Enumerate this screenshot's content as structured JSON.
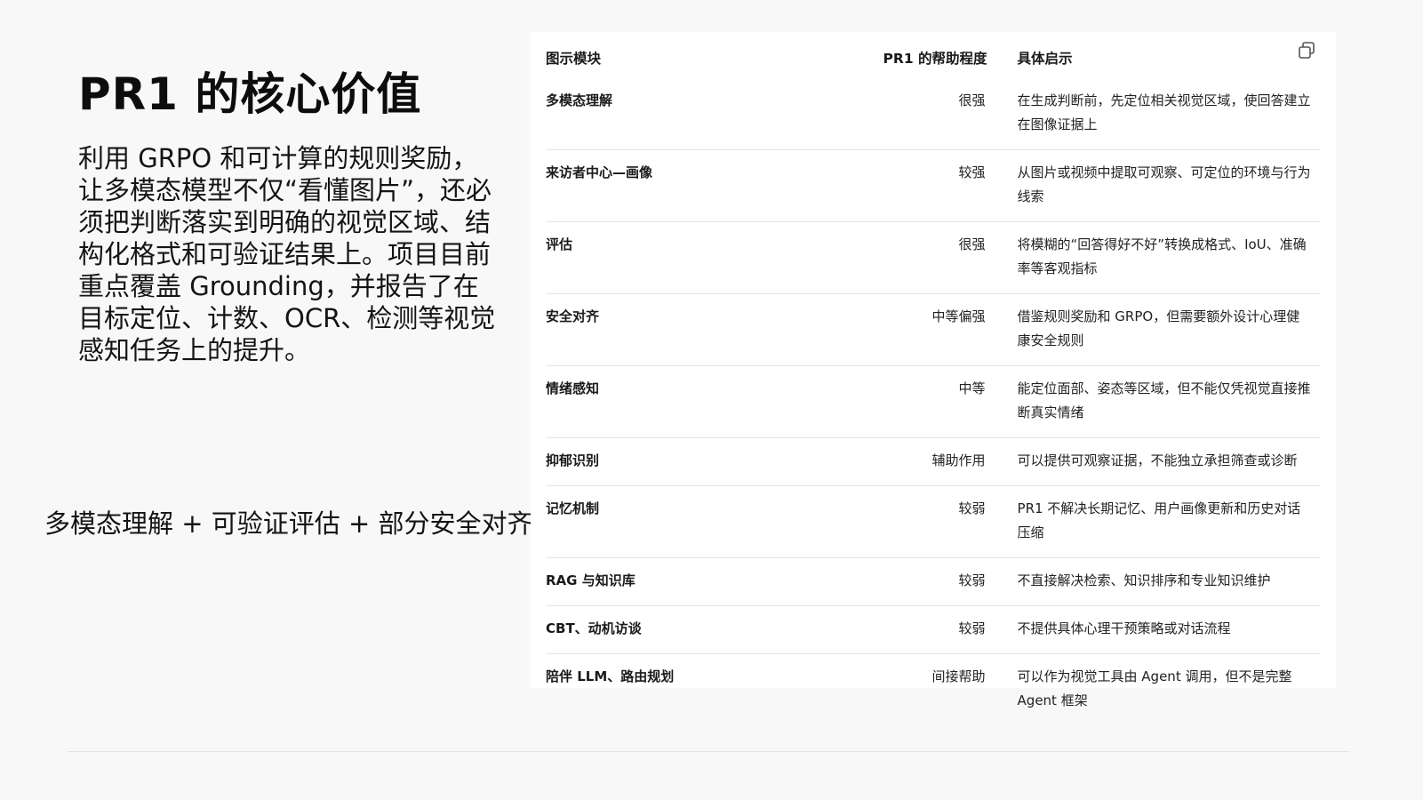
{
  "slide": {
    "title": "PR1 的核心价值",
    "body": "利用 GRPO 和可计算的规则奖励，让多模态模型不仅“看懂图片”，还必须把判断落实到明确的视觉区域、结构化格式和可验证结果上。项目目前重点覆盖 Grounding，并报告了在目标定位、计数、OCR、检测等视觉感知任务上的提升。",
    "summary": "多模态理解 + 可验证评估 + 部分安全对齐"
  },
  "table": {
    "headers": {
      "module": "图示模块",
      "level": "PR1 的帮助程度",
      "insight": "具体启示"
    },
    "copy_icon": "copy-icon",
    "rows": [
      {
        "module": "多模态理解",
        "level": "很强",
        "insight": "在生成判断前，先定位相关视觉区域，使回答建立在图像证据上"
      },
      {
        "module": "来访者中心—画像",
        "level": "较强",
        "insight": "从图片或视频中提取可观察、可定位的环境与行为线索"
      },
      {
        "module": "评估",
        "level": "很强",
        "insight": "将模糊的“回答得好不好”转换成格式、IoU、准确率等客观指标"
      },
      {
        "module": "安全对齐",
        "level": "中等偏强",
        "insight": "借鉴规则奖励和 GRPO，但需要额外设计心理健康安全规则"
      },
      {
        "module": "情绪感知",
        "level": "中等",
        "insight": "能定位面部、姿态等区域，但不能仅凭视觉直接推断真实情绪"
      },
      {
        "module": "抑郁识别",
        "level": "辅助作用",
        "insight": "可以提供可观察证据，不能独立承担筛查或诊断"
      },
      {
        "module": "记忆机制",
        "level": "较弱",
        "insight": "PR1 不解决长期记忆、用户画像更新和历史对话压缩"
      },
      {
        "module": "RAG 与知识库",
        "level": "较弱",
        "insight": "不直接解决检索、知识排序和专业知识维护"
      },
      {
        "module": "CBT、动机访谈",
        "level": "较弱",
        "insight": "不提供具体心理干预策略或对话流程"
      },
      {
        "module": "陪伴 LLM、路由规划",
        "level": "间接帮助",
        "insight": "可以作为视觉工具由 Agent 调用，但不是完整 Agent 框架"
      }
    ]
  }
}
